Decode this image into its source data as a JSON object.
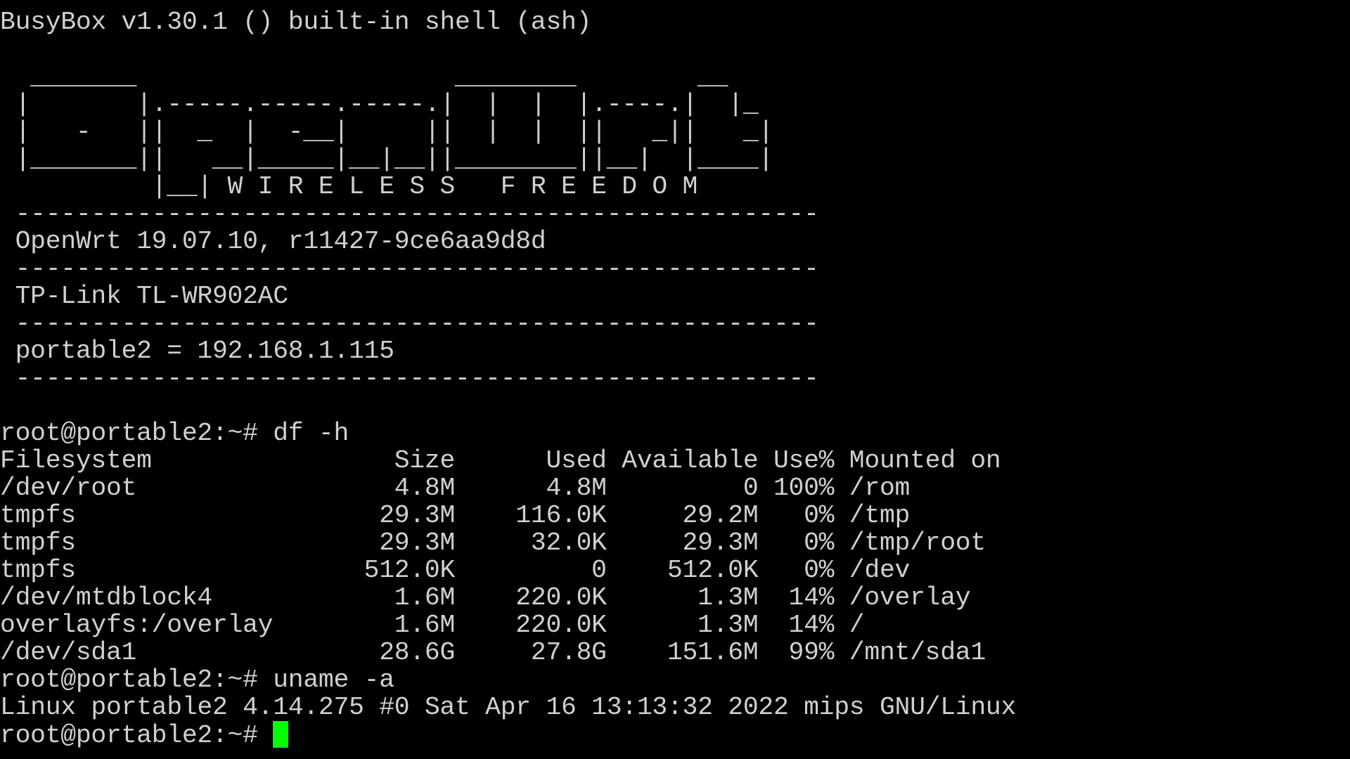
{
  "terminal": {
    "lines": [
      "BusyBox v1.30.1 () built-in shell (ash)",
      "",
      "  _______                     ________        __",
      " |       |.-----.-----.-----.|  |  |  |.----.|  |_",
      " |   -   ||  _  |  -__|     ||  |  |  ||   _||   _|",
      " |_______||   __|_____|__|__||________||__|  |____|",
      "          |__| W I R E L E S S   F R E E D O M",
      " -----------------------------------------------------",
      " OpenWrt 19.07.10, r11427-9ce6aa9d8d",
      " -----------------------------------------------------",
      " TP-Link TL-WR902AC",
      " -----------------------------------------------------",
      " portable2 = 192.168.1.115",
      " -----------------------------------------------------",
      "",
      "root@portable2:~# df -h",
      "Filesystem                Size      Used Available Use% Mounted on",
      "/dev/root                 4.8M      4.8M         0 100% /rom",
      "tmpfs                    29.3M    116.0K     29.2M   0% /tmp",
      "tmpfs                    29.3M     32.0K     29.3M   0% /tmp/root",
      "tmpfs                   512.0K         0    512.0K   0% /dev",
      "/dev/mtdblock4            1.6M    220.0K      1.3M  14% /overlay",
      "overlayfs:/overlay        1.6M    220.0K      1.3M  14% /",
      "/dev/sda1                28.6G     27.8G    151.6M  99% /mnt/sda1",
      "root@portable2:~# uname -a",
      "Linux portable2 4.14.275 #0 Sat Apr 16 13:13:32 2022 mips GNU/Linux"
    ],
    "prompt": "root@portable2:~# ",
    "text_color": "#d0d0d0",
    "background_color": "#000000",
    "cursor_color": "#00ff00"
  }
}
